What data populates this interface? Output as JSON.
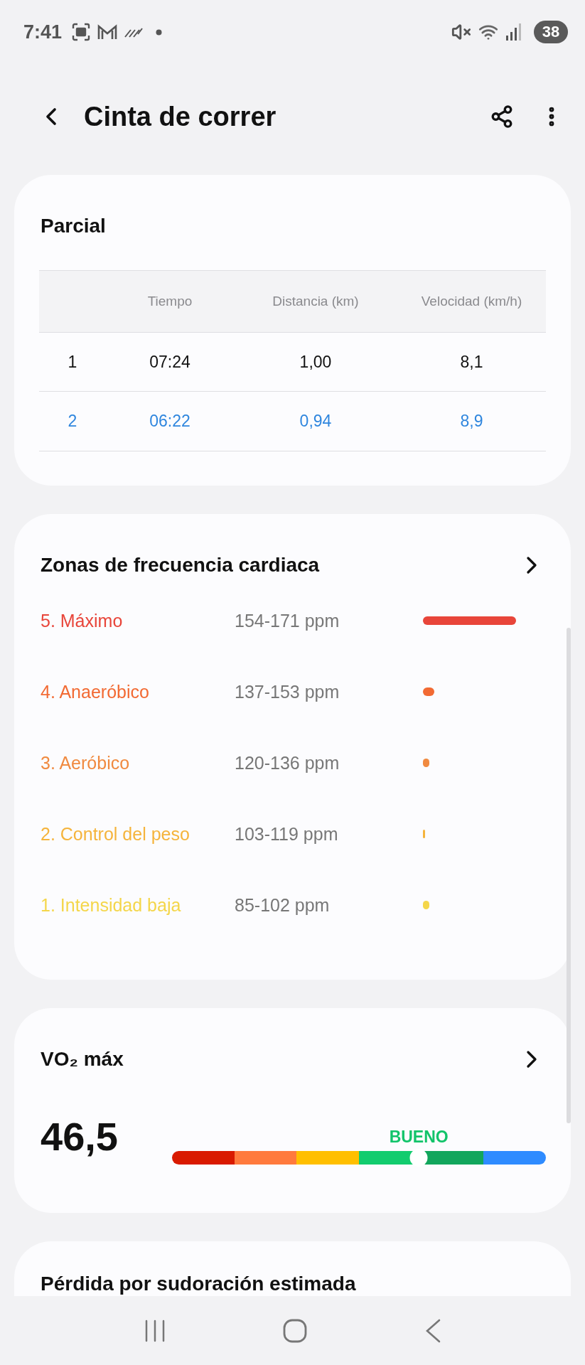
{
  "status_bar": {
    "time": "7:41",
    "battery": "38"
  },
  "header": {
    "title": "Cinta de correr"
  },
  "splits": {
    "title": "Parcial",
    "columns": [
      "Tiempo",
      "Distancia (km)",
      "Velocidad (km/h)"
    ],
    "rows": [
      {
        "lap": "1",
        "time": "07:24",
        "distance": "1,00",
        "speed": "8,1",
        "selected": false
      },
      {
        "lap": "2",
        "time": "06:22",
        "distance": "0,94",
        "speed": "8,9",
        "selected": true
      }
    ]
  },
  "heart_zones": {
    "title": "Zonas de frecuencia cardiaca",
    "zones": [
      {
        "label": "5. Máximo",
        "range": "154-171 ppm",
        "color": "#e8453a"
      },
      {
        "label": "4. Anaeróbico",
        "range": "137-153 ppm",
        "color": "#f26a33"
      },
      {
        "label": "3. Aeróbico",
        "range": "120-136 ppm",
        "color": "#f08a40"
      },
      {
        "label": "2. Control del peso",
        "range": "103-119 ppm",
        "color": "#f5b43c"
      },
      {
        "label": "1. Intensidad baja",
        "range": "85-102 ppm",
        "color": "#f4d64a"
      }
    ]
  },
  "vo2max": {
    "title": "VO₂ máx",
    "value": "46,5",
    "rating": "BUENO",
    "scale": [
      {
        "color": "#d91a00"
      },
      {
        "color": "#ff7a3d"
      },
      {
        "color": "#ffbf00"
      },
      {
        "color": "#12cc6e"
      },
      {
        "color": "#12a65c"
      },
      {
        "color": "#2e8bff"
      }
    ]
  },
  "sweat": {
    "title": "Pérdida por sudoración estimada"
  }
}
